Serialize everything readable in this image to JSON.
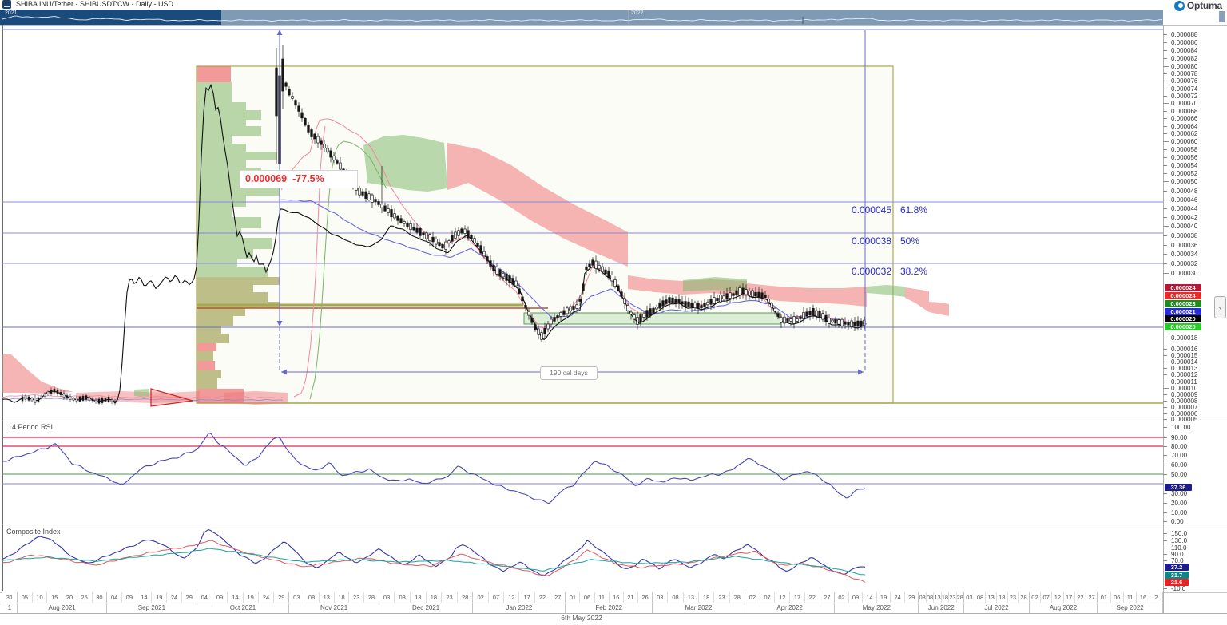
{
  "title_bar": {
    "title": "SHIBA INU/Tether - SHIBUSDT:CW - Daily - USD",
    "logo_text": "Optuma"
  },
  "navigator": {
    "years": [
      "2021",
      "2022"
    ]
  },
  "chart": {
    "annotations": {
      "measure": "0.000069  -77.5%",
      "duration": "190 cal days",
      "fib_levels": [
        {
          "price": "0.000045",
          "percent": "61.8%"
        },
        {
          "price": "0.000038",
          "percent": "50%"
        },
        {
          "price": "0.000032",
          "percent": "38.2%"
        }
      ]
    },
    "price_axis_ticks": [
      "0.000088",
      "0.000086",
      "0.000084",
      "0.000082",
      "0.000080",
      "0.000078",
      "0.000076",
      "0.000074",
      "0.000072",
      "0.000070",
      "0.000068",
      "0.000066",
      "0.000064",
      "0.000062",
      "0.000060",
      "0.000058",
      "0.000056",
      "0.000054",
      "0.000052",
      "0.000050",
      "0.000048",
      "0.000046",
      "0.000044",
      "0.000042",
      "0.000040",
      "0.000038",
      "0.000036",
      "0.000034",
      "0.000032",
      "0.000030",
      "0.000018",
      "0.000016",
      "0.000015",
      "0.000014",
      "0.000013",
      "0.000012",
      "0.000011",
      "0.000010",
      "0.000009",
      "0.000008",
      "0.000007",
      "0.000006",
      "0.000005"
    ],
    "price_labels": [
      {
        "value": "0.000024",
        "bg": "#b41737"
      },
      {
        "value": "0.000024",
        "bg": "#e62b2b"
      },
      {
        "value": "0.000023",
        "bg": "#1f8a1f"
      },
      {
        "value": "0.000021",
        "bg": "#2a2ae0"
      },
      {
        "value": "0.000020",
        "bg": "#000000"
      },
      {
        "value": "0.000020",
        "bg": "#27cc27"
      }
    ]
  },
  "rsi": {
    "label": "14 Period RSI",
    "value": "37.36",
    "value_bg": "#1c1c8c",
    "ticks": [
      "100.00",
      "90.00",
      "80.00",
      "70.00",
      "60.00",
      "50.00",
      "30.00",
      "20.00",
      "10.00",
      "0.00"
    ]
  },
  "composite": {
    "label": "Composite Index",
    "values": [
      {
        "value": "37.2",
        "bg": "#1c1c8c"
      },
      {
        "value": "31.7",
        "bg": "#0f8585"
      },
      {
        "value": "21.6",
        "bg": "#e62222"
      }
    ],
    "ticks": [
      "150.0",
      "130.0",
      "110.0",
      "90.0",
      "70.0",
      "-10.0"
    ]
  },
  "date_axis": {
    "lead": {
      "label": "1",
      "days": [
        "31"
      ]
    },
    "months": [
      {
        "label": "Aug 2021",
        "days": [
          "05",
          "10",
          "15",
          "20",
          "25",
          "30"
        ]
      },
      {
        "label": "Sep 2021",
        "days": [
          "04",
          "09",
          "14",
          "19",
          "24",
          "29"
        ]
      },
      {
        "label": "Oct 2021",
        "days": [
          "04",
          "09",
          "14",
          "19",
          "24",
          "29"
        ]
      },
      {
        "label": "Nov 2021",
        "days": [
          "03",
          "08",
          "13",
          "18",
          "23",
          "28"
        ]
      },
      {
        "label": "Dec 2021",
        "days": [
          "03",
          "08",
          "13",
          "18",
          "23",
          "28"
        ]
      },
      {
        "label": "Jan 2022",
        "days": [
          "02",
          "07",
          "12",
          "17",
          "22",
          "27"
        ]
      },
      {
        "label": "Feb 2022",
        "days": [
          "01",
          "06",
          "11",
          "16",
          "21",
          "26"
        ]
      },
      {
        "label": "Mar 2022",
        "days": [
          "03",
          "08",
          "13",
          "18",
          "23",
          "28"
        ]
      },
      {
        "label": "Apr 2022",
        "days": [
          "02",
          "07",
          "12",
          "17",
          "22",
          "27"
        ]
      },
      {
        "label": "May 2022",
        "days": [
          "02",
          "09",
          "14",
          "19",
          "24",
          "29"
        ]
      },
      {
        "label": "Jun 2022",
        "days": [
          "03",
          "08",
          "13",
          "18",
          "23",
          "28"
        ]
      },
      {
        "label": "Jul 2022",
        "days": [
          "03",
          "08",
          "13",
          "18",
          "23",
          "28"
        ]
      },
      {
        "label": "Aug 2022",
        "days": [
          "02",
          "07",
          "12",
          "17",
          "22",
          "27"
        ]
      },
      {
        "label": "Sep 2022",
        "days": [
          "01",
          "06",
          "11",
          "16",
          "2"
        ]
      }
    ]
  },
  "footer": {
    "date_label": "6th May 2022"
  },
  "controls": {
    "collapse_glyph": "‹"
  },
  "chart_data": {
    "type": "candlestick",
    "title": "SHIBA INU/Tether - SHIBUSDT:CW - Daily - USD",
    "overlays": [
      "Ichimoku Cloud",
      "Volume Profile",
      "Fibonacci Retracement",
      "Price/Time Measure",
      "Support Zone"
    ],
    "indicators": [
      {
        "name": "14 Period RSI",
        "current": 37.36
      },
      {
        "name": "Composite Index",
        "current": [
          37.2,
          31.7,
          21.6
        ]
      }
    ],
    "price_scale": {
      "min": 5e-06,
      "max": 8.8e-05
    },
    "current_price_labels": [
      2.4e-05,
      2.4e-05,
      2.3e-05,
      2.1e-05,
      2e-05,
      2e-05
    ],
    "fibonacci_retracement": [
      {
        "percent": 61.8,
        "price": 4.5e-05
      },
      {
        "percent": 50,
        "price": 3.8e-05
      },
      {
        "percent": 38.2,
        "price": 3.2e-05
      }
    ],
    "measure": {
      "price_change": -6.9e-05,
      "percent_change": -77.5,
      "duration": "190 cal days"
    },
    "x_axis_range": [
      "31 Jul 2021",
      "21 Sep 2022"
    ],
    "session_date": "6th May 2022",
    "approx_close_path": [
      {
        "date": "2021-08-01",
        "price": 7e-06
      },
      {
        "date": "2021-09-01",
        "price": 7.5e-06
      },
      {
        "date": "2021-09-16",
        "price": 2.8e-05
      },
      {
        "date": "2021-10-03",
        "price": 2.7e-05
      },
      {
        "date": "2021-10-07",
        "price": 8e-05
      },
      {
        "date": "2021-10-15",
        "price": 3.3e-05
      },
      {
        "date": "2021-10-27",
        "price": 8.8e-05
      },
      {
        "date": "2021-11-10",
        "price": 5.6e-05
      },
      {
        "date": "2021-12-01",
        "price": 3.8e-05
      },
      {
        "date": "2021-12-15",
        "price": 3.35e-05
      },
      {
        "date": "2022-01-10",
        "price": 3e-05
      },
      {
        "date": "2022-01-22",
        "price": 2.05e-05
      },
      {
        "date": "2022-02-08",
        "price": 3.2e-05
      },
      {
        "date": "2022-02-24",
        "price": 2.3e-05
      },
      {
        "date": "2022-03-15",
        "price": 2.45e-05
      },
      {
        "date": "2022-04-05",
        "price": 2.7e-05
      },
      {
        "date": "2022-04-28",
        "price": 2.35e-05
      },
      {
        "date": "2022-05-06",
        "price": 2.03e-05
      }
    ]
  }
}
